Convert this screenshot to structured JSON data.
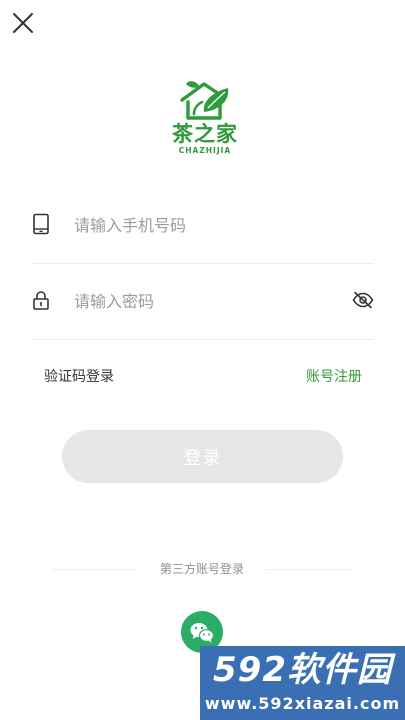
{
  "icons": {
    "close": "close-icon",
    "phone": "tablet-icon",
    "password": "lock-icon",
    "visibility": "eye-slash-icon",
    "wechat": "wechat-icon"
  },
  "colors": {
    "brand_green": "#2f9a3c",
    "wechat_green": "#2aae67",
    "disabled_button": "#e6e6e6",
    "divider": "#ececec",
    "watermark_blue": "#3b6fb3"
  },
  "logo": {
    "name": "茶之家",
    "subtitle": "CHAZHIJIA"
  },
  "form": {
    "phone_placeholder": "请输入手机号码",
    "password_placeholder": "请输入密码"
  },
  "links": {
    "sms_login": "验证码登录",
    "register": "账号注册"
  },
  "login_button": "登录",
  "third_party": {
    "label": "第三方账号登录"
  },
  "watermark": {
    "brand": "592软件园",
    "url": "www.592xiazai.com"
  }
}
